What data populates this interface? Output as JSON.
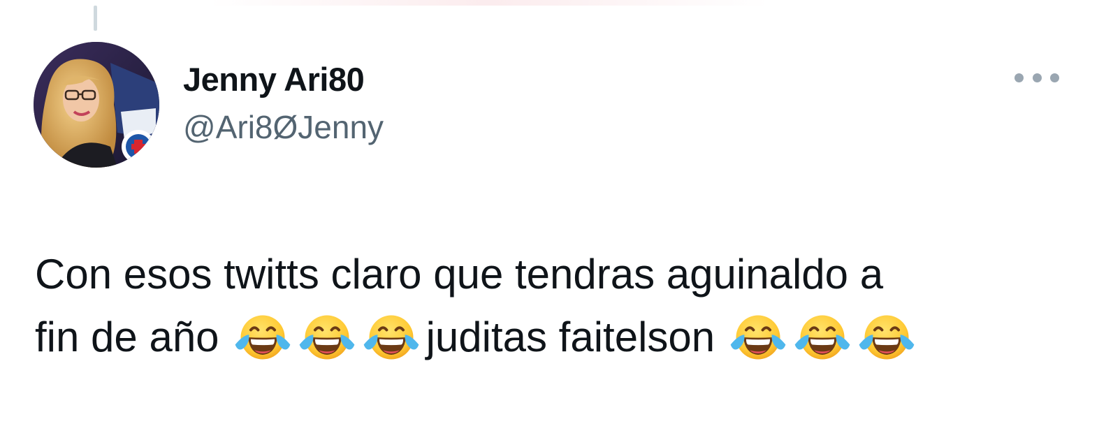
{
  "tweet": {
    "author": {
      "display_name": "Jenny Ari80",
      "handle": "@Ari8ØJenny",
      "avatar": "avatar-photo"
    },
    "more_icon": "more-horizontal-icon",
    "text": {
      "line1": "Con esos twitts claro que tendras aguinaldo a",
      "line2_start": "fin de año",
      "line2_mid": "juditas faitelson",
      "emoji_name": "face-with-tears-of-joy-icon"
    }
  },
  "colors": {
    "text": "#0f1419",
    "secondary": "#536471",
    "thread_line": "#cfd9de"
  }
}
